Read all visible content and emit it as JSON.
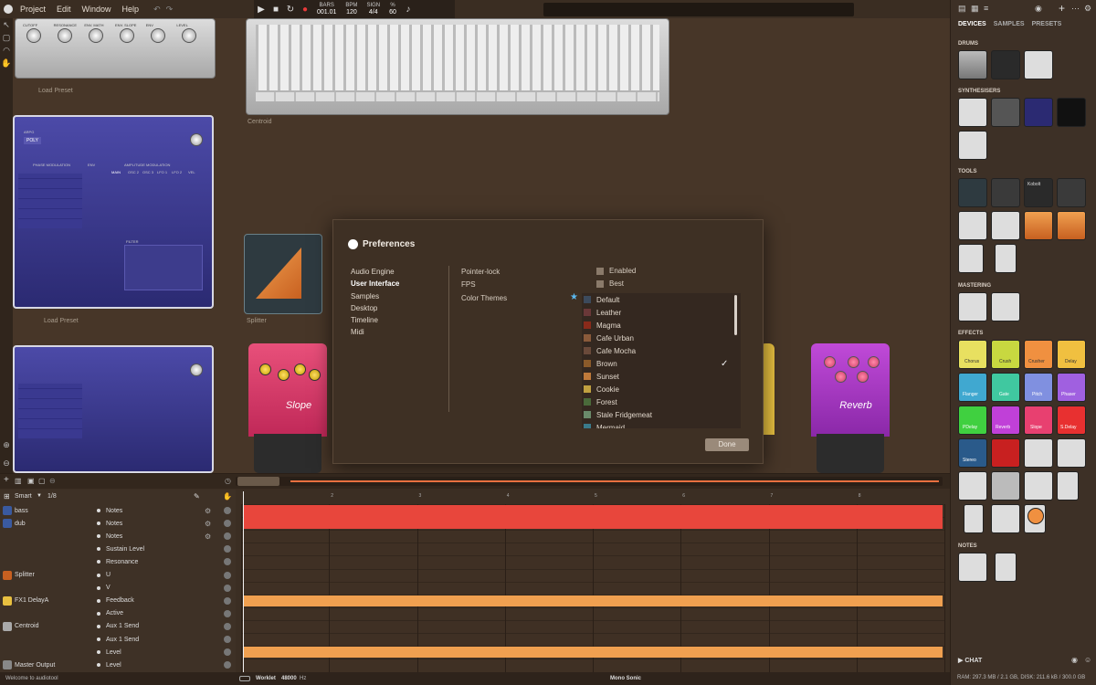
{
  "menu": {
    "items": [
      "Project",
      "Edit",
      "Window",
      "Help"
    ]
  },
  "transport": {
    "bars_label": "BARS",
    "bars_value": "001.01",
    "bpm_label": "BPM",
    "bpm_value": "120",
    "sign_label": "SIGN",
    "sign_value": "4/4",
    "pct_label": "%",
    "pct_value": "60"
  },
  "devices": {
    "top_knobs": [
      "CUTOFF",
      "RESONANCE",
      "ENV. MATH",
      "ENV. SLOPE",
      "ENV",
      "LEVEL"
    ],
    "load_preset_1": "Load Preset",
    "load_preset_2": "Load Preset",
    "centroid_label": "Centroid",
    "splitter_label": "Splitter",
    "slope_pedal": "Slope",
    "reverb_pedal": "Reverb",
    "synth_tags": [
      "ARPG",
      "POLY",
      "PHASE MODULATION",
      "ENV",
      "AMPLITUDE MODULATION",
      "MAIN",
      "OSC 2",
      "OSC 3",
      "LFO 1",
      "LFO 2",
      "VEL",
      "FILTER"
    ]
  },
  "preferences": {
    "title": "Preferences",
    "nav": [
      "Audio Engine",
      "User Interface",
      "Samples",
      "Desktop",
      "Timeline",
      "Midi"
    ],
    "options": [
      {
        "label": "Pointer-lock",
        "value": "Enabled"
      },
      {
        "label": "FPS",
        "value": "Best"
      },
      {
        "label": "Color Themes",
        "value": ""
      }
    ],
    "themes": [
      {
        "name": "Default",
        "color": "#3c4a5c"
      },
      {
        "name": "Leather",
        "color": "#6a3838"
      },
      {
        "name": "Magma",
        "color": "#8a2a1a"
      },
      {
        "name": "Cafe Urban",
        "color": "#8a5a3a"
      },
      {
        "name": "Cafe Mocha",
        "color": "#6a4a3a"
      },
      {
        "name": "Brown",
        "color": "#8a5a2a"
      },
      {
        "name": "Sunset",
        "color": "#c07a3a"
      },
      {
        "name": "Cookie",
        "color": "#c0a040"
      },
      {
        "name": "Forest",
        "color": "#4a6a3a"
      },
      {
        "name": "Stale Fridgemeat",
        "color": "#6a8a6a"
      },
      {
        "name": "Mermaid",
        "color": "#3a7a8a"
      }
    ],
    "selected_theme": "Brown",
    "done_label": "Done"
  },
  "browser": {
    "tabs": [
      "DEVICES",
      "SAMPLES",
      "PRESETS"
    ],
    "sections": [
      "DRUMS",
      "SYNTHESISERS",
      "TOOLS",
      "MASTERING",
      "EFFECTS",
      "NOTES"
    ],
    "effects": [
      "Chorus",
      "Crush",
      "Crusher",
      "Delay",
      "Flanger",
      "Gate",
      "Pitch",
      "Phaser",
      "PDelay",
      "Reverb",
      "Slope",
      "S.Delay",
      "Stereo"
    ],
    "tool_label": "Kobolt",
    "chat": "CHAT"
  },
  "sequencer": {
    "snap": "Smart",
    "division": "1/8",
    "tracks": [
      {
        "track": "bass",
        "param": "Notes"
      },
      {
        "track": "dub",
        "param": "Notes"
      },
      {
        "track": "",
        "param": "Notes"
      },
      {
        "track": "",
        "param": "Sustain Level"
      },
      {
        "track": "",
        "param": "Resonance"
      },
      {
        "track": "Splitter",
        "param": "U"
      },
      {
        "track": "",
        "param": "V"
      },
      {
        "track": "FX1 DelayA",
        "param": "Feedback"
      },
      {
        "track": "",
        "param": "Active"
      },
      {
        "track": "Centroid",
        "param": "Aux 1 Send"
      },
      {
        "track": "",
        "param": "Aux 1 Send"
      },
      {
        "track": "",
        "param": "Level"
      },
      {
        "track": "Master Output",
        "param": "Level"
      }
    ],
    "bar_numbers": [
      "2",
      "3",
      "4",
      "5",
      "6",
      "7",
      "8"
    ]
  },
  "status": {
    "welcome": "Welcome to audiotool",
    "engine": "Worklet",
    "rate": "48000",
    "rate_unit": "Hz",
    "center": "Mono Sonic",
    "ram": "RAM: 297.3 MB / 2.1 GB, DISK: 211.6 kB / 300.0 GB"
  },
  "colors": {
    "accent": "#e8463c",
    "orange": "#f0a050",
    "bg": "#4a3a2c"
  }
}
